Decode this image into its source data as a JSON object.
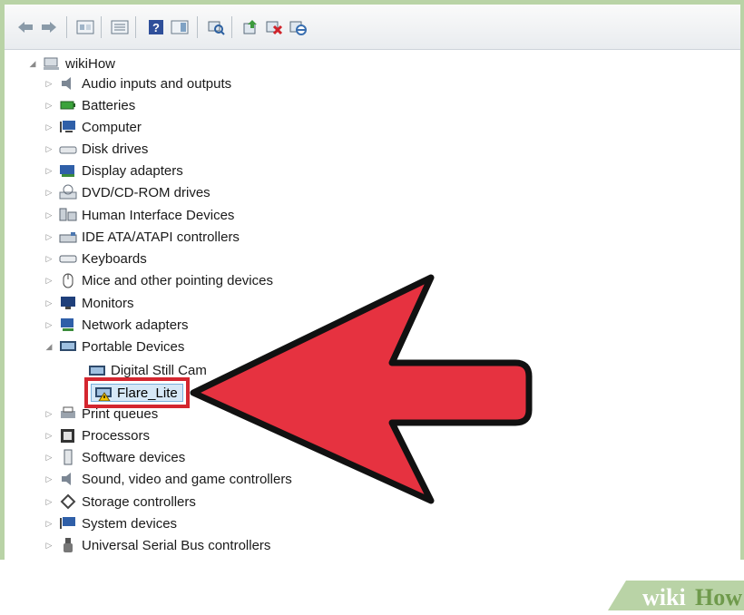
{
  "toolbar": {
    "buttons": [
      "back-arrow-icon",
      "forward-arrow-icon",
      "properties-icon",
      "show-hide-console-tree-icon",
      "help-icon",
      "action-pane-icon",
      "scan-hardware-icon",
      "update-driver-icon",
      "uninstall-device-icon",
      "disable-device-icon"
    ]
  },
  "tree": {
    "root": "wikiHow",
    "categories": [
      {
        "label": "Audio inputs and outputs",
        "icon": "speaker-icon"
      },
      {
        "label": "Batteries",
        "icon": "battery-icon"
      },
      {
        "label": "Computer",
        "icon": "computer-icon"
      },
      {
        "label": "Disk drives",
        "icon": "disk-drive-icon"
      },
      {
        "label": "Display adapters",
        "icon": "display-adapter-icon"
      },
      {
        "label": "DVD/CD-ROM drives",
        "icon": "dvd-drive-icon"
      },
      {
        "label": "Human Interface Devices",
        "icon": "hid-icon"
      },
      {
        "label": "IDE ATA/ATAPI controllers",
        "icon": "ide-controller-icon"
      },
      {
        "label": "Keyboards",
        "icon": "keyboard-icon"
      },
      {
        "label": "Mice and other pointing devices",
        "icon": "mouse-icon"
      },
      {
        "label": "Monitors",
        "icon": "monitor-icon"
      },
      {
        "label": "Network adapters",
        "icon": "network-adapter-icon"
      },
      {
        "label": "Portable Devices",
        "icon": "portable-device-icon",
        "expanded": true,
        "children": [
          {
            "label": "Digital Still Cam"
          },
          {
            "label": "Flare_Lite",
            "selected": true
          }
        ]
      },
      {
        "label": "Print queues",
        "icon": "printer-icon"
      },
      {
        "label": "Processors",
        "icon": "processor-icon"
      },
      {
        "label": "Software devices",
        "icon": "software-device-icon"
      },
      {
        "label": "Sound, video and game controllers",
        "icon": "sound-controller-icon"
      },
      {
        "label": "Storage controllers",
        "icon": "storage-controller-icon"
      },
      {
        "label": "System devices",
        "icon": "system-device-icon"
      },
      {
        "label": "Universal Serial Bus controllers",
        "icon": "usb-icon"
      }
    ]
  },
  "watermark": {
    "part1": "wiki",
    "part2": "How"
  },
  "colors": {
    "highlight": "#d4262f",
    "arrow": "#e63240",
    "frame": "#b9d3a6"
  }
}
